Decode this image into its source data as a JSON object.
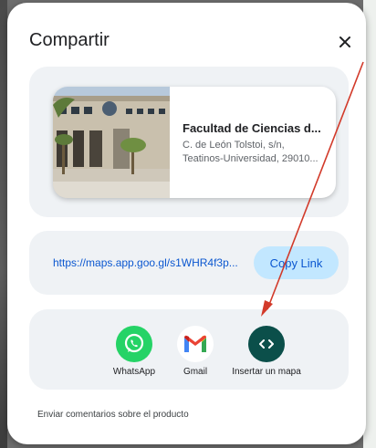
{
  "dialog": {
    "title": "Compartir",
    "close_icon": "close-icon"
  },
  "place": {
    "name": "Facultad de Ciencias d...",
    "address_line1": "C. de León Tolstoi, s/n,",
    "address_line2": "Teatinos-Universidad, 29010..."
  },
  "link": {
    "url": "https://maps.app.goo.gl/s1WHR4f3p...",
    "copy_label": "Copy Link"
  },
  "share": {
    "items": [
      {
        "label": "WhatsApp",
        "icon": "whatsapp-icon",
        "color": "#25d366"
      },
      {
        "label": "Gmail",
        "icon": "gmail-icon",
        "color": "#ea4335"
      },
      {
        "label": "Insertar un mapa",
        "icon": "embed-code-icon",
        "color": "#0b4f4a"
      }
    ]
  },
  "feedback": {
    "label": "Enviar comentarios sobre el producto"
  },
  "colors": {
    "accent": "#0b57d0",
    "copy_button_bg": "#c2e7ff",
    "annotation_arrow": "#d23a2a"
  }
}
